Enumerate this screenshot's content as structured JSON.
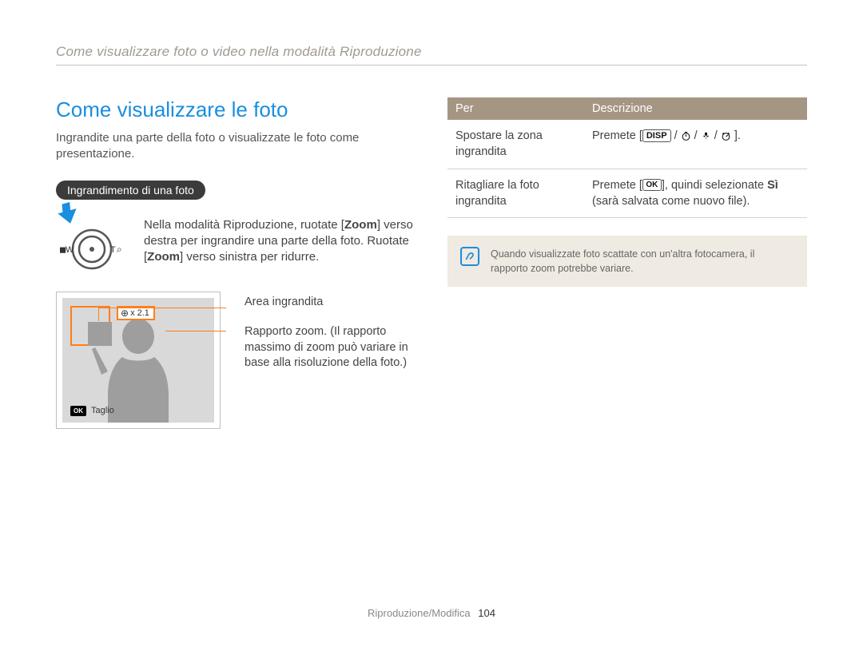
{
  "breadcrumb": "Come visualizzare foto o video nella modalità Riproduzione",
  "title": "Come visualizzare le foto",
  "intro": "Ingrandite una parte della foto o visualizzate le foto come presentazione.",
  "pill": "Ingrandimento di una foto",
  "dial": {
    "left_label": "W",
    "right_label": "T",
    "text_pre": "Nella modalità Riproduzione, ruotate [",
    "zoom_word": "Zoom",
    "text_mid": "] verso destra per ingrandire una parte della foto. Ruotate [",
    "text_post": "] verso sinistra per ridurre."
  },
  "screen": {
    "zoom_ratio": "x 2.1",
    "taglio": "Taglio"
  },
  "callouts": {
    "area": "Area ingrandita",
    "ratio": "Rapporto zoom. (Il rapporto massimo di zoom può variare in base alla risoluzione della foto.)"
  },
  "table": {
    "head_per": "Per",
    "head_desc": "Descrizione",
    "row1_per": "Spostare la zona ingrandita",
    "row1_desc_pre": "Premete [",
    "row1_desc_label": "DISP",
    "row1_desc_post": "].",
    "row2_per": "Ritagliare la foto ingrandita",
    "row2_desc_pre": "Premete [",
    "row2_desc_ok": "OK",
    "row2_desc_mid": "], quindi selezionate ",
    "row2_desc_si": "Sì",
    "row2_desc_post": " (sarà salvata come nuovo file)."
  },
  "note": "Quando visualizzate foto scattate con un'altra fotocamera, il rapporto zoom potrebbe variare.",
  "footer_section": "Riproduzione/Modifica",
  "footer_page": "104"
}
